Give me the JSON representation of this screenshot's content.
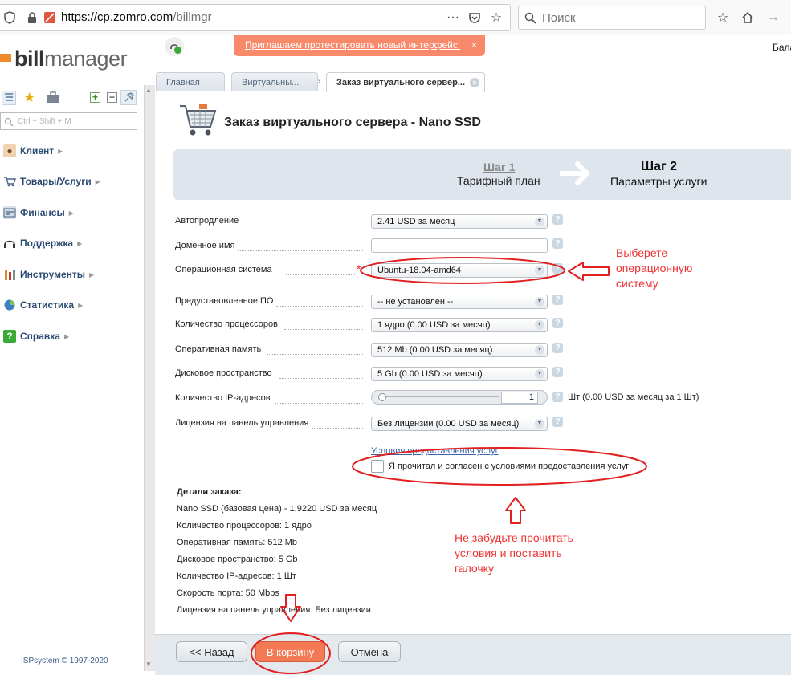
{
  "browser": {
    "url_host": "https://cp.zomro.com",
    "url_path": "/billmgr",
    "search_placeholder": "Поиск"
  },
  "header": {
    "logo_prefix": "bill",
    "logo_suffix": "manager",
    "notice_text": "Приглашаем протестировать новый интерфейс!",
    "notice_close": "×",
    "balance_label": "Бала"
  },
  "sidebar": {
    "quick_placeholder": "Ctrl + Shift + M",
    "items": [
      {
        "label": "Клиент",
        "icon": "user-icon"
      },
      {
        "label": "Товары/Услуги",
        "icon": "cart-icon"
      },
      {
        "label": "Финансы",
        "icon": "finance-icon"
      },
      {
        "label": "Поддержка",
        "icon": "headset-icon"
      },
      {
        "label": "Инструменты",
        "icon": "tools-icon"
      },
      {
        "label": "Статистика",
        "icon": "pie-chart-icon"
      },
      {
        "label": "Справка",
        "icon": "help-book-icon"
      }
    ],
    "copyright": "ISPsystem © 1997-2020"
  },
  "tabs": [
    {
      "label": "Главная"
    },
    {
      "label": "Виртуальны..."
    },
    {
      "label": "Заказ виртуального сервер..."
    }
  ],
  "page": {
    "title": "Заказ виртуального сервера - Nano SSD",
    "step1_title": "Шаг 1",
    "step1_sub": "Тарифный план",
    "step2_title": "Шаг 2",
    "step2_sub": "Параметры услуги"
  },
  "form": {
    "autorenew": {
      "label": "Автопродление",
      "value": "2.41 USD за месяц"
    },
    "domain": {
      "label": "Доменное имя",
      "value": ""
    },
    "os": {
      "label": "Операционная система",
      "value": "Ubuntu-18.04-amd64",
      "required_mark": "*"
    },
    "preinstalled": {
      "label": "Предустановленное ПО",
      "value": "-- не установлен --"
    },
    "cpu": {
      "label": "Количество процессоров",
      "value": "1 ядро (0.00 USD за месяц)"
    },
    "ram": {
      "label": "Оперативная память",
      "value": "512 Mb (0.00 USD за месяц)"
    },
    "disk": {
      "label": "Дисковое пространство",
      "value": "5 Gb (0.00 USD за месяц)"
    },
    "ip": {
      "label": "Количество IP-адресов",
      "value": "1",
      "unit": "Шт (0.00 USD за месяц за 1 Шт)"
    },
    "license": {
      "label": "Лицензия на панель управления",
      "value": "Без лицензии (0.00 USD за месяц)"
    },
    "terms_link": "Условия предоставления услуг",
    "agree_label": "Я прочитал и согласен с условиями предоставления услуг",
    "help_glyph": "?"
  },
  "details": {
    "title": "Детали заказа:",
    "lines": [
      "Nano SSD (базовая цена) - 1.9220 USD за месяц",
      "Количество процессоров: 1 ядро",
      "Оперативная память: 512 Mb",
      "Дисковое пространство: 5 Gb",
      "Количество IP-адресов: 1 Шт",
      "Скорость порта: 50 Mbps",
      "Лицензия на панель управления: Без лицензии"
    ]
  },
  "buttons": {
    "back": "<< Назад",
    "cart": "В корзину",
    "cancel": "Отмена"
  },
  "annotations": {
    "os_note": [
      "Выберете",
      "операционную",
      "систему"
    ],
    "terms_note": [
      "Не забудьте прочитать",
      "условия и поставить",
      "галочку"
    ],
    "color": "#e32020"
  }
}
